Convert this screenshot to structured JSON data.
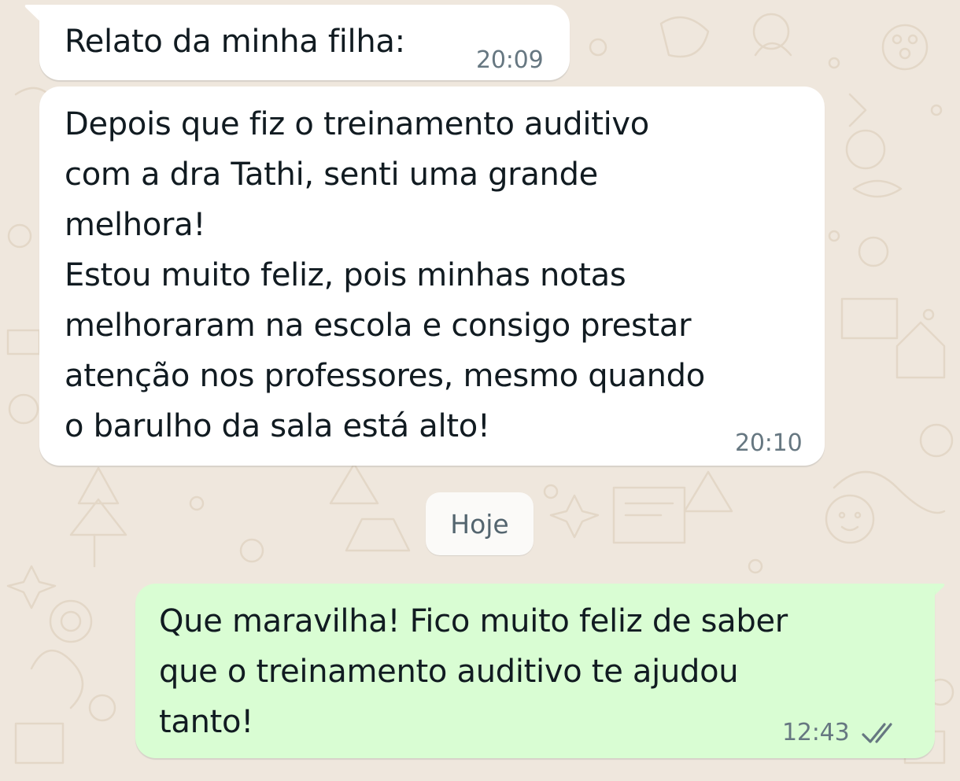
{
  "chat": {
    "messages": [
      {
        "direction": "incoming",
        "text": "Relato da minha filha:",
        "time": "20:09"
      },
      {
        "direction": "incoming",
        "text": "Depois que fiz o treinamento auditivo\ncom a dra Tathi, senti uma grande\nmelhora!\nEstou muito feliz, pois minhas notas\nmelhoraram na escola e consigo prestar\natenção nos professores, mesmo quando\no barulho da sala está alto!",
        "time": "20:10"
      },
      {
        "direction": "outgoing",
        "text": "Que maravilha! Fico muito feliz de saber\nque o treinamento auditivo te ajudou\ntanto!",
        "time": "12:43",
        "status_icon": "double-check-icon"
      }
    ],
    "date_separator": "Hoje"
  },
  "colors": {
    "background": "#efe7dd",
    "incoming_bubble": "#ffffff",
    "outgoing_bubble": "#d9fdd3",
    "timestamp": "#667781",
    "read_ticks": "#667781"
  }
}
